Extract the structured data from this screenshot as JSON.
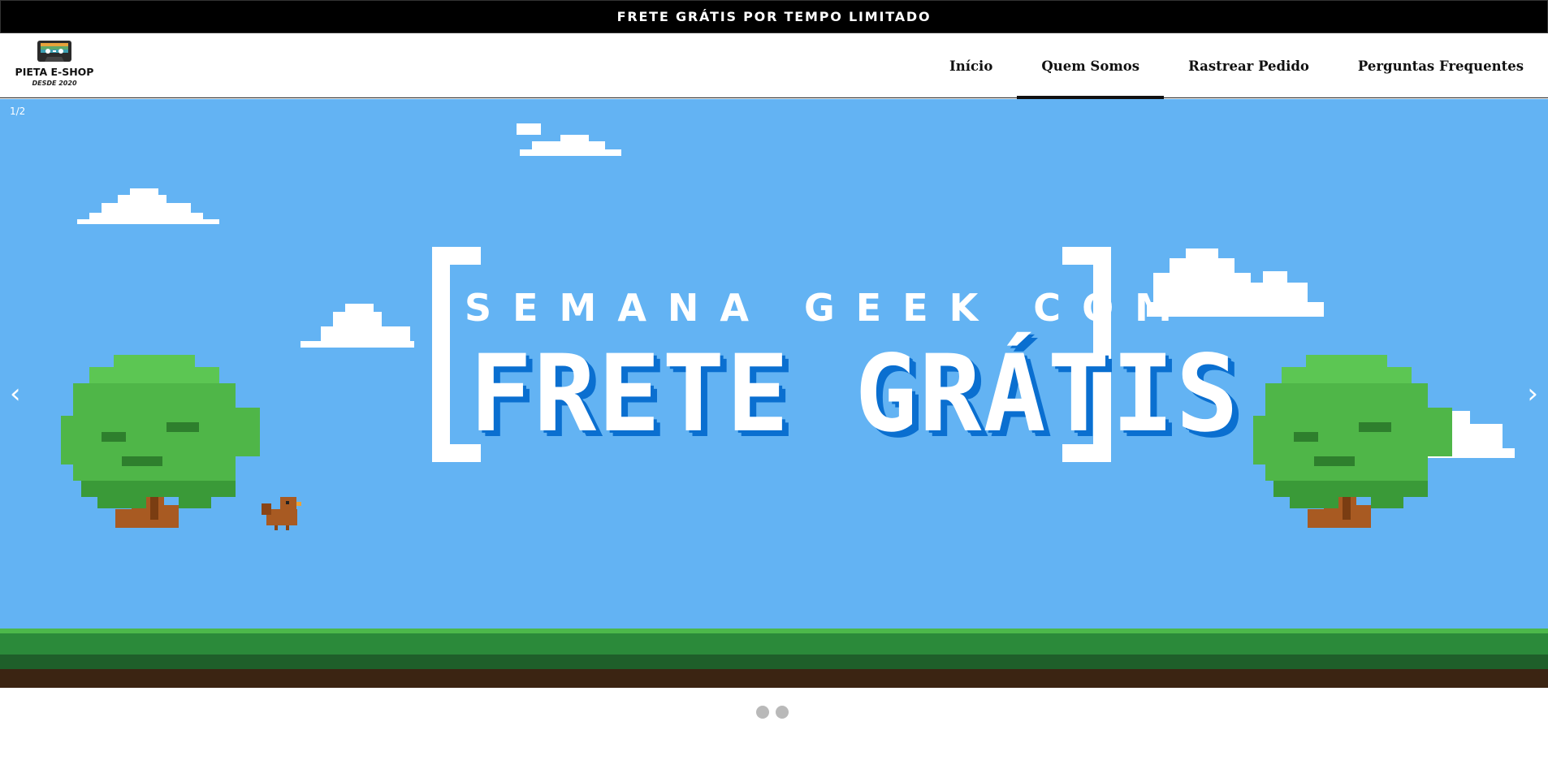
{
  "promo": {
    "text": "FRETE GRÁTIS POR TEMPO LIMITADO"
  },
  "logo": {
    "name": "PIETA E-SHOP",
    "since": "DESDE 2020"
  },
  "nav": {
    "items": [
      {
        "label": "Início"
      },
      {
        "label": "Quem Somos",
        "active": true
      },
      {
        "label": "Rastrear Pedido"
      },
      {
        "label": "Perguntas Frequentes"
      }
    ]
  },
  "slider": {
    "counter": "1/2",
    "prev_icon": "‹",
    "next_icon": "›",
    "current_slide": 1,
    "total_slides": 2
  },
  "banner": {
    "headline_top": "SEMANA GEEK COM",
    "headline_main": "FRETE GRÁTIS"
  },
  "colors": {
    "sky": "#63b3f3",
    "headline_shadow": "#0a6fd0",
    "grass_light": "#4cb84a",
    "grass_dark": "#2b8a3a",
    "soil": "#3b2412"
  }
}
